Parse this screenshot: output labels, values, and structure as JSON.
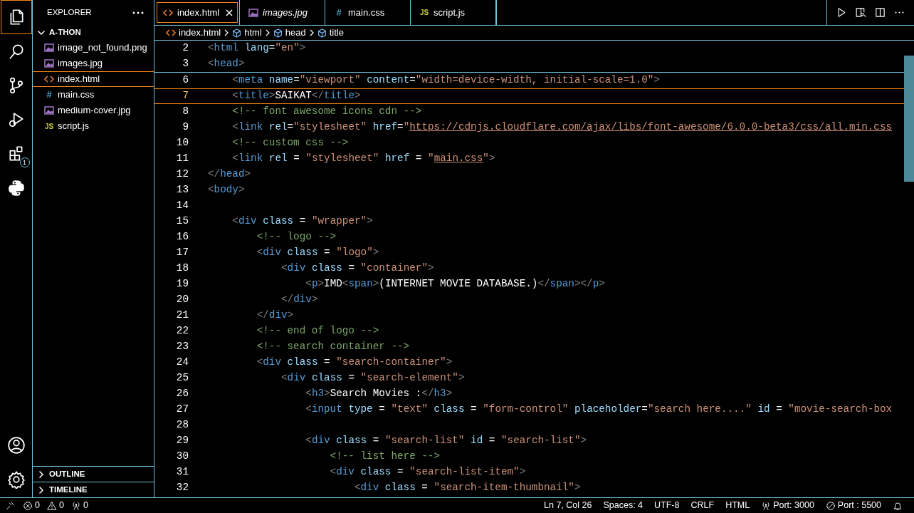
{
  "activity_bar": {
    "top": [
      {
        "kind": "explorer",
        "selected": true
      },
      {
        "kind": "search",
        "selected": false
      },
      {
        "kind": "source-control",
        "selected": false
      },
      {
        "kind": "run-debug",
        "selected": false
      },
      {
        "kind": "extensions",
        "selected": false,
        "badge": "1"
      },
      {
        "kind": "python",
        "selected": false
      }
    ],
    "bottom": [
      {
        "kind": "account"
      },
      {
        "kind": "settings"
      }
    ]
  },
  "sidebar": {
    "title": "EXPLORER",
    "folder": {
      "label": "A-THON",
      "expanded": true,
      "files": [
        {
          "label": "image_not_found.png",
          "kind": "image",
          "selected": false
        },
        {
          "label": "images.jpg",
          "kind": "image",
          "selected": false
        },
        {
          "label": "index.html",
          "kind": "html",
          "selected": true
        },
        {
          "label": "main.css",
          "kind": "css",
          "icon": "#",
          "selected": false
        },
        {
          "label": "medium-cover.jpg",
          "kind": "image",
          "selected": false
        },
        {
          "label": "script.js",
          "kind": "js",
          "icon": "JS",
          "selected": false
        }
      ]
    },
    "sections": [
      {
        "label": "OUTLINE",
        "expanded": false
      },
      {
        "label": "TIMELINE",
        "expanded": false
      }
    ]
  },
  "tabs": [
    {
      "label": "index.html",
      "kind": "html",
      "selected": true,
      "preview": false
    },
    {
      "label": "images.jpg",
      "kind": "image",
      "selected": false,
      "preview": true
    },
    {
      "label": "main.css",
      "kind": "css",
      "icon": "#",
      "selected": false,
      "preview": false
    },
    {
      "label": "script.js",
      "kind": "js",
      "icon": "JS",
      "selected": false,
      "preview": false
    }
  ],
  "editor_actions": [
    {
      "kind": "run"
    },
    {
      "kind": "preview"
    },
    {
      "kind": "split"
    },
    {
      "kind": "more"
    }
  ],
  "breadcrumbs": [
    {
      "label": "index.html",
      "kind": "file"
    },
    {
      "label": "html",
      "kind": "element"
    },
    {
      "label": "head",
      "kind": "element"
    },
    {
      "label": "title",
      "kind": "element"
    }
  ],
  "sticky_scroll": [
    {
      "number": "2",
      "current": false,
      "text": "<html lang=\"en\">"
    },
    {
      "number": "3",
      "current": false,
      "text": "<head>"
    }
  ],
  "lines": [
    {
      "number": "6",
      "current": false,
      "text": "    <meta name=\"viewport\" content=\"width=device-width, initial-scale=1.0\">"
    },
    {
      "number": "7",
      "current": true,
      "text": "    <title>SAIKAT</title>"
    },
    {
      "number": "8",
      "current": false,
      "text": "    <!-- font awesome icons cdn -->"
    },
    {
      "number": "9",
      "current": false,
      "text": "    <link rel=\"stylesheet\" href=\"https://cdnjs.cloudflare.com/ajax/libs/font-awesome/6.0.0-beta3/css/all.min.css"
    },
    {
      "number": "10",
      "current": false,
      "text": "    <!-- custom css -->"
    },
    {
      "number": "11",
      "current": false,
      "text": "    <link rel = \"stylesheet\" href = \"main.css\">"
    },
    {
      "number": "12",
      "current": false,
      "text": "</head>"
    },
    {
      "number": "13",
      "current": false,
      "text": "<body>"
    },
    {
      "number": "14",
      "current": false
    },
    {
      "number": "15",
      "current": false,
      "text": "    <div class = \"wrapper\">"
    },
    {
      "number": "16",
      "current": false,
      "text": "        <!-- logo -->"
    },
    {
      "number": "17",
      "current": false,
      "text": "        <div class = \"logo\">"
    },
    {
      "number": "18",
      "current": false,
      "text": "            <div class = \"container\">"
    },
    {
      "number": "19",
      "current": false,
      "text": "                <p>IMD<span>(INTERNET MOVIE DATABASE.)</span></p>"
    },
    {
      "number": "20",
      "current": false,
      "text": "            </div>"
    },
    {
      "number": "21",
      "current": false,
      "text": "        </div>"
    },
    {
      "number": "22",
      "current": false,
      "text": "        <!-- end of logo -->"
    },
    {
      "number": "23",
      "current": false,
      "text": "        <!-- search container -->"
    },
    {
      "number": "24",
      "current": false,
      "text": "        <div class = \"search-container\">"
    },
    {
      "number": "25",
      "current": false,
      "text": "            <div class = \"search-element\">"
    },
    {
      "number": "26",
      "current": false,
      "text": "                <h3>Search Movies :</h3>"
    },
    {
      "number": "27",
      "current": false,
      "text": "                <input type = \"text\" class = \"form-control\" placeholder=\"search here....\" id = \"movie-search-box"
    },
    {
      "number": "28",
      "current": false
    },
    {
      "number": "29",
      "current": false,
      "text": "                <div class = \"search-list\" id = \"search-list\">"
    },
    {
      "number": "30",
      "current": false,
      "text": "                    <!-- list here -->"
    },
    {
      "number": "31",
      "current": false,
      "text": "                    <div class = \"search-list-item\">"
    },
    {
      "number": "32",
      "current": false,
      "text": "                        <div class = \"search-item-thumbnail\">"
    }
  ],
  "status_bar": {
    "left": [
      {
        "kind": "remote"
      },
      {
        "kind": "errors",
        "text": "0"
      },
      {
        "kind": "warnings",
        "text": "0"
      },
      {
        "kind": "broadcast",
        "text": "0"
      }
    ],
    "right": [
      {
        "kind": "text",
        "text": "Ln 7, Col 26"
      },
      {
        "kind": "text",
        "text": "Spaces: 4"
      },
      {
        "kind": "text",
        "text": "UTF-8"
      },
      {
        "kind": "text",
        "text": "CRLF"
      },
      {
        "kind": "text",
        "text": "HTML"
      },
      {
        "kind": "broadcast",
        "text": "Port: 3000"
      },
      {
        "kind": "blocked",
        "text": "Port : 5500"
      },
      {
        "kind": "bell"
      }
    ]
  }
}
